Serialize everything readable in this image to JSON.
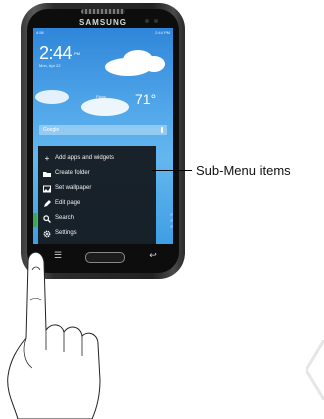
{
  "phone": {
    "brand": "SAMSUNG",
    "status_left": "4:56",
    "status_right": "2:44 PM",
    "clock_time": "2:44",
    "clock_ampm": "PM",
    "date": "Mon, Apr 22",
    "location": "Plano",
    "temperature": "71°",
    "search_label": "Google"
  },
  "menu": {
    "items": [
      {
        "icon": "plus-icon",
        "label": "Add apps and widgets"
      },
      {
        "icon": "folder-icon",
        "label": "Create folder"
      },
      {
        "icon": "wallpaper-icon",
        "label": "Set wallpaper"
      },
      {
        "icon": "edit-icon",
        "label": "Edit page"
      },
      {
        "icon": "search-icon",
        "label": "Search"
      },
      {
        "icon": "gear-icon",
        "label": "Settings"
      }
    ]
  },
  "callout": {
    "label": "Sub-Menu items"
  },
  "colors": {
    "screen_sky": "#4fa5e8",
    "menu_bg": "#14181e",
    "callout_line": "#000000",
    "accent_green": "#3da85a"
  }
}
